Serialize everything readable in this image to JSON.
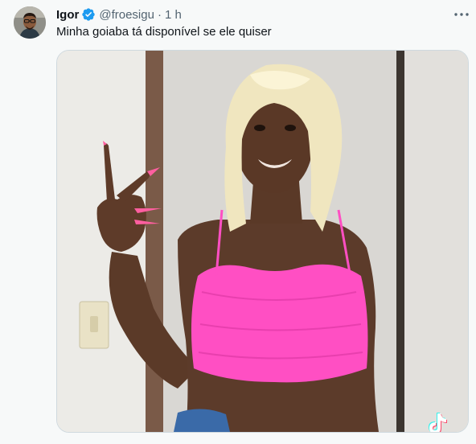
{
  "tweet": {
    "author_name": "Igor",
    "handle": "@froesigu",
    "separator": "·",
    "time": "1 h",
    "text": "Minha goiaba tá disponível se ele quiser"
  },
  "icons": {
    "verified": "verified-badge-icon",
    "more": "more-options-icon",
    "watermark": "tiktok-logo-icon"
  },
  "colors": {
    "verified": "#1d9bf0",
    "top": "#ff4fc3"
  }
}
